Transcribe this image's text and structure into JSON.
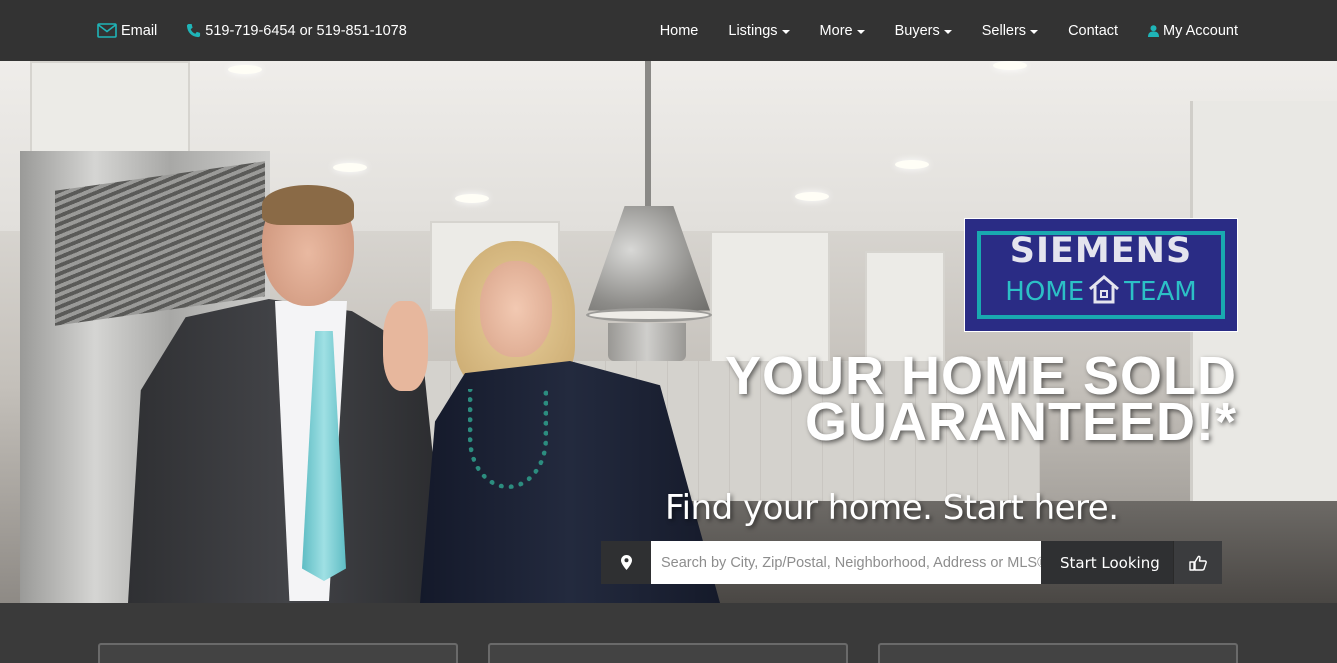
{
  "topbar": {
    "email_label": "Email",
    "phone_label": "519-719-6454 or 519-851-1078",
    "nav": [
      {
        "label": "Home",
        "dropdown": false
      },
      {
        "label": "Listings",
        "dropdown": true
      },
      {
        "label": "More",
        "dropdown": true
      },
      {
        "label": "Buyers",
        "dropdown": true
      },
      {
        "label": "Sellers",
        "dropdown": true
      },
      {
        "label": "Contact",
        "dropdown": false
      }
    ],
    "account_label": "My Account"
  },
  "logo": {
    "title": "SIEMENS",
    "sub_left": "HOME",
    "sub_right": "TEAM"
  },
  "hero": {
    "headline_line1": "YOUR HOME SOLD",
    "headline_line2": "GUARANTEED!*",
    "subheadline": "Find your home. Start here."
  },
  "search": {
    "placeholder": "Search by City, Zip/Postal, Neighborhood, Address or MLS®",
    "button_label": "Start Looking"
  },
  "icons": {
    "email": "envelope-icon",
    "phone": "phone-icon",
    "account": "user-icon",
    "location": "map-pin-icon",
    "go": "thumbs-up-pointer-icon",
    "logo_house": "house-icon"
  },
  "colors": {
    "topbar_bg": "#333333",
    "accent_teal": "#1fb5b8",
    "logo_bg": "#2a2c85",
    "button_bg": "#2f3032"
  }
}
